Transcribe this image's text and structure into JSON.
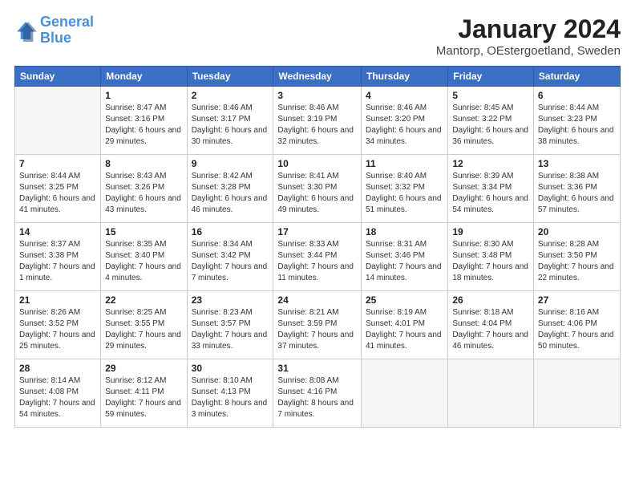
{
  "header": {
    "logo_line1": "General",
    "logo_line2": "Blue",
    "title": "January 2024",
    "subtitle": "Mantorp, OEstergoetland, Sweden"
  },
  "calendar": {
    "days_of_week": [
      "Sunday",
      "Monday",
      "Tuesday",
      "Wednesday",
      "Thursday",
      "Friday",
      "Saturday"
    ],
    "weeks": [
      [
        {
          "day": "",
          "empty": true
        },
        {
          "day": "1",
          "sunrise": "Sunrise: 8:47 AM",
          "sunset": "Sunset: 3:16 PM",
          "daylight": "Daylight: 6 hours and 29 minutes."
        },
        {
          "day": "2",
          "sunrise": "Sunrise: 8:46 AM",
          "sunset": "Sunset: 3:17 PM",
          "daylight": "Daylight: 6 hours and 30 minutes."
        },
        {
          "day": "3",
          "sunrise": "Sunrise: 8:46 AM",
          "sunset": "Sunset: 3:19 PM",
          "daylight": "Daylight: 6 hours and 32 minutes."
        },
        {
          "day": "4",
          "sunrise": "Sunrise: 8:46 AM",
          "sunset": "Sunset: 3:20 PM",
          "daylight": "Daylight: 6 hours and 34 minutes."
        },
        {
          "day": "5",
          "sunrise": "Sunrise: 8:45 AM",
          "sunset": "Sunset: 3:22 PM",
          "daylight": "Daylight: 6 hours and 36 minutes."
        },
        {
          "day": "6",
          "sunrise": "Sunrise: 8:44 AM",
          "sunset": "Sunset: 3:23 PM",
          "daylight": "Daylight: 6 hours and 38 minutes."
        }
      ],
      [
        {
          "day": "7",
          "sunrise": "Sunrise: 8:44 AM",
          "sunset": "Sunset: 3:25 PM",
          "daylight": "Daylight: 6 hours and 41 minutes."
        },
        {
          "day": "8",
          "sunrise": "Sunrise: 8:43 AM",
          "sunset": "Sunset: 3:26 PM",
          "daylight": "Daylight: 6 hours and 43 minutes."
        },
        {
          "day": "9",
          "sunrise": "Sunrise: 8:42 AM",
          "sunset": "Sunset: 3:28 PM",
          "daylight": "Daylight: 6 hours and 46 minutes."
        },
        {
          "day": "10",
          "sunrise": "Sunrise: 8:41 AM",
          "sunset": "Sunset: 3:30 PM",
          "daylight": "Daylight: 6 hours and 49 minutes."
        },
        {
          "day": "11",
          "sunrise": "Sunrise: 8:40 AM",
          "sunset": "Sunset: 3:32 PM",
          "daylight": "Daylight: 6 hours and 51 minutes."
        },
        {
          "day": "12",
          "sunrise": "Sunrise: 8:39 AM",
          "sunset": "Sunset: 3:34 PM",
          "daylight": "Daylight: 6 hours and 54 minutes."
        },
        {
          "day": "13",
          "sunrise": "Sunrise: 8:38 AM",
          "sunset": "Sunset: 3:36 PM",
          "daylight": "Daylight: 6 hours and 57 minutes."
        }
      ],
      [
        {
          "day": "14",
          "sunrise": "Sunrise: 8:37 AM",
          "sunset": "Sunset: 3:38 PM",
          "daylight": "Daylight: 7 hours and 1 minute."
        },
        {
          "day": "15",
          "sunrise": "Sunrise: 8:35 AM",
          "sunset": "Sunset: 3:40 PM",
          "daylight": "Daylight: 7 hours and 4 minutes."
        },
        {
          "day": "16",
          "sunrise": "Sunrise: 8:34 AM",
          "sunset": "Sunset: 3:42 PM",
          "daylight": "Daylight: 7 hours and 7 minutes."
        },
        {
          "day": "17",
          "sunrise": "Sunrise: 8:33 AM",
          "sunset": "Sunset: 3:44 PM",
          "daylight": "Daylight: 7 hours and 11 minutes."
        },
        {
          "day": "18",
          "sunrise": "Sunrise: 8:31 AM",
          "sunset": "Sunset: 3:46 PM",
          "daylight": "Daylight: 7 hours and 14 minutes."
        },
        {
          "day": "19",
          "sunrise": "Sunrise: 8:30 AM",
          "sunset": "Sunset: 3:48 PM",
          "daylight": "Daylight: 7 hours and 18 minutes."
        },
        {
          "day": "20",
          "sunrise": "Sunrise: 8:28 AM",
          "sunset": "Sunset: 3:50 PM",
          "daylight": "Daylight: 7 hours and 22 minutes."
        }
      ],
      [
        {
          "day": "21",
          "sunrise": "Sunrise: 8:26 AM",
          "sunset": "Sunset: 3:52 PM",
          "daylight": "Daylight: 7 hours and 25 minutes."
        },
        {
          "day": "22",
          "sunrise": "Sunrise: 8:25 AM",
          "sunset": "Sunset: 3:55 PM",
          "daylight": "Daylight: 7 hours and 29 minutes."
        },
        {
          "day": "23",
          "sunrise": "Sunrise: 8:23 AM",
          "sunset": "Sunset: 3:57 PM",
          "daylight": "Daylight: 7 hours and 33 minutes."
        },
        {
          "day": "24",
          "sunrise": "Sunrise: 8:21 AM",
          "sunset": "Sunset: 3:59 PM",
          "daylight": "Daylight: 7 hours and 37 minutes."
        },
        {
          "day": "25",
          "sunrise": "Sunrise: 8:19 AM",
          "sunset": "Sunset: 4:01 PM",
          "daylight": "Daylight: 7 hours and 41 minutes."
        },
        {
          "day": "26",
          "sunrise": "Sunrise: 8:18 AM",
          "sunset": "Sunset: 4:04 PM",
          "daylight": "Daylight: 7 hours and 46 minutes."
        },
        {
          "day": "27",
          "sunrise": "Sunrise: 8:16 AM",
          "sunset": "Sunset: 4:06 PM",
          "daylight": "Daylight: 7 hours and 50 minutes."
        }
      ],
      [
        {
          "day": "28",
          "sunrise": "Sunrise: 8:14 AM",
          "sunset": "Sunset: 4:08 PM",
          "daylight": "Daylight: 7 hours and 54 minutes."
        },
        {
          "day": "29",
          "sunrise": "Sunrise: 8:12 AM",
          "sunset": "Sunset: 4:11 PM",
          "daylight": "Daylight: 7 hours and 59 minutes."
        },
        {
          "day": "30",
          "sunrise": "Sunrise: 8:10 AM",
          "sunset": "Sunset: 4:13 PM",
          "daylight": "Daylight: 8 hours and 3 minutes."
        },
        {
          "day": "31",
          "sunrise": "Sunrise: 8:08 AM",
          "sunset": "Sunset: 4:16 PM",
          "daylight": "Daylight: 8 hours and 7 minutes."
        },
        {
          "day": "",
          "empty": true
        },
        {
          "day": "",
          "empty": true
        },
        {
          "day": "",
          "empty": true
        }
      ]
    ]
  }
}
